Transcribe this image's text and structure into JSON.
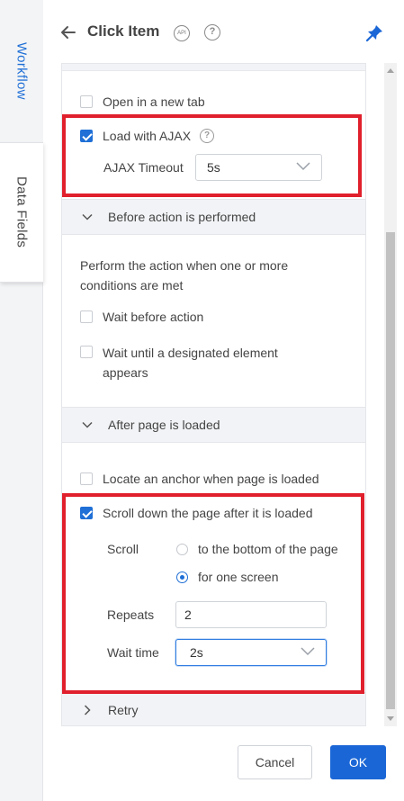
{
  "sidebar": {
    "tabs": [
      {
        "label": "Workflow",
        "active": true
      },
      {
        "label": "Data Fields",
        "active": false
      }
    ]
  },
  "header": {
    "title": "Click Item",
    "api_badge": "API"
  },
  "options": {
    "open_new_tab": {
      "label": "Open in a new tab",
      "checked": false
    },
    "load_ajax": {
      "label": "Load with AJAX",
      "checked": true
    },
    "ajax_timeout": {
      "label": "AJAX Timeout",
      "value": "5s"
    }
  },
  "before_action": {
    "title": "Before action is performed",
    "description": "Perform the action when one or more conditions are met",
    "wait_before": {
      "label": "Wait before action",
      "checked": false
    },
    "wait_element": {
      "label": "Wait until a designated element appears",
      "checked": false
    }
  },
  "after_load": {
    "title": "After page is loaded",
    "locate_anchor": {
      "label": "Locate an anchor when page is loaded",
      "checked": false
    },
    "scroll_down": {
      "label": "Scroll down the page after it is loaded",
      "checked": true
    },
    "scroll": {
      "label": "Scroll",
      "options": [
        "to the bottom of the page",
        "for one screen"
      ],
      "selected": "for one screen"
    },
    "repeats": {
      "label": "Repeats",
      "value": "2"
    },
    "wait_time": {
      "label": "Wait time",
      "value": "2s"
    }
  },
  "retry": {
    "title": "Retry"
  },
  "footer": {
    "cancel_label": "Cancel",
    "ok_label": "OK"
  },
  "colors": {
    "accent": "#1f6fd6",
    "highlight_box": "#e0202c",
    "primary_button": "#1a66d6"
  }
}
